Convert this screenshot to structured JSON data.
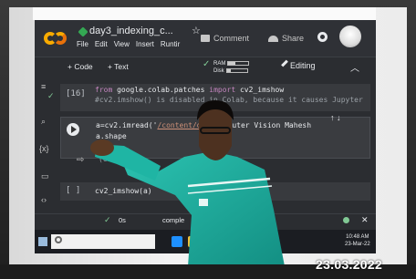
{
  "notebook": {
    "title": "day3_indexing_c...",
    "menu": [
      "File",
      "Edit",
      "View",
      "Insert",
      "Runtir"
    ],
    "comment_label": "Comment",
    "share_label": "Share"
  },
  "toolbar": {
    "add_code": "+ Code",
    "add_text": "+ Text",
    "ram_label": "RAM",
    "disk_label": "Disk",
    "editing_label": "Editing"
  },
  "cells": [
    {
      "number": "[16]",
      "line1_keyword_from": "from",
      "line1_module": "google.colab.patches",
      "line1_keyword_import": "import",
      "line1_name": "cv2_imshow",
      "line2": "#cv2.imshow() is disabled in Colab, because it causes Jupyter"
    },
    {
      "line1_prefix": "a=cv2.imread('",
      "line1_path": "/content/dr",
      "line1_suffix": "r/Computer Vision Mahesh",
      "line2": "a.shape",
      "output": "(612,"
    },
    {
      "number": "[ ]",
      "code": "cv2_imshow(a)"
    }
  ],
  "status": {
    "time": "0s",
    "completed": "comple"
  },
  "taskbar": {
    "clock_time": "10:48 AM",
    "clock_date": "23-Mar-22"
  },
  "photo": {
    "date_stamp": "23.03.2022"
  },
  "colors": {
    "colab_bg": "#2b2d31",
    "accent_orange": "#f9ab00",
    "shirt_teal": "#1fb5a4"
  }
}
